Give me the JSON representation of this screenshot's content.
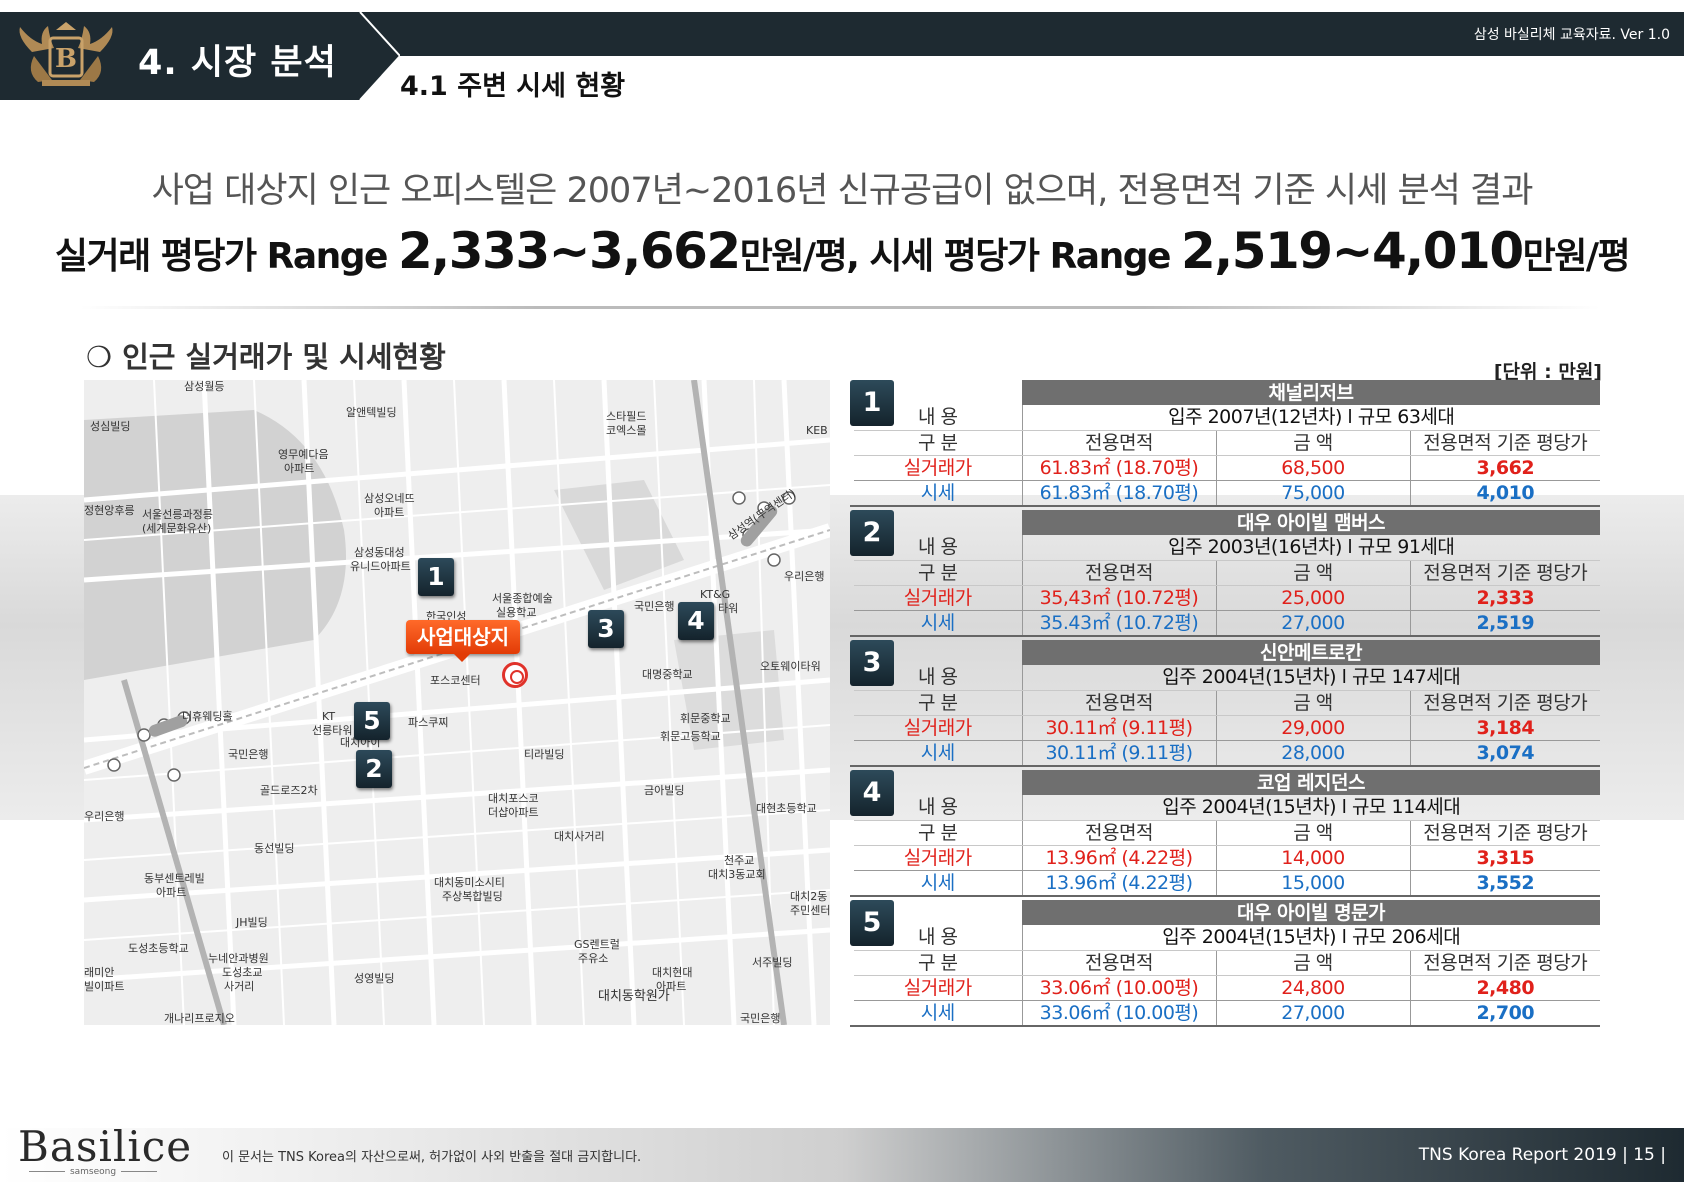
{
  "header": {
    "section_title": "4. 시장 분석",
    "subsection_title": "4.1 주변 시세 현황",
    "doc_version": "삼성 바실리체 교육자료. Ver 1.0"
  },
  "headline": {
    "line1": "사업 대상지 인근 오피스텔은 2007년~2016년 신규공급이 없으며, 전용면적 기준 시세 분석 결과",
    "line2_a": "실거래 평당가 Range ",
    "line2_b": "2,333~3,662",
    "line2_c": "만원/평, 시세 평당가 Range ",
    "line2_d": "2,519~4,010",
    "line2_e": "만원/평"
  },
  "block": {
    "heading": "❍ 인근 실거래가 및 시세현황",
    "unit": "[단위 : 만원]"
  },
  "map": {
    "site_label": "사업대상지",
    "pins": [
      "1",
      "2",
      "3",
      "4",
      "5"
    ],
    "labels": [
      "삼성월등",
      "알앤텍빌딩",
      "스타필드",
      "코엑스몰",
      "성심빌딩",
      "영무예다음",
      "아파트",
      "KEB",
      "삼성오네뜨",
      "아파트",
      "서울선릉과정릉",
      "(세계문화유산)",
      "정현앙후릉",
      "삼성동대성",
      "유니드아파트",
      "우리은행",
      "삼성역(무역센터)",
      "서울종합예술",
      "실용학교",
      "국민은행",
      "KT&G",
      "타워",
      "한국인성",
      "포스코센터",
      "대명중학교",
      "오토웨이타워",
      "더휴웨딩홀",
      "KT",
      "선릉타워",
      "파스쿠찌",
      "휘문중학교",
      "휘문고등학교",
      "국민은행",
      "대치아이",
      "티라빌딩",
      "골드로즈2차",
      "금아빌딩",
      "대현초등학교",
      "대치포스코",
      "더샵아파트",
      "우리은행",
      "대치사거리",
      "동선빌딩",
      "천주교",
      "대치3동교회",
      "동부센트레빌",
      "아파트",
      "대치동미소시티",
      "주상복합빌딩",
      "대치2동",
      "주민센터",
      "JH빌딩",
      "GS렌트럴",
      "주유소",
      "도성초등학교",
      "누네안과병원",
      "서주빌딩",
      "래미안",
      "빌이파트",
      "도성초교",
      "사거리",
      "성영빌딩",
      "대치현대",
      "아파트",
      "대치동학원가",
      "개나리프로지오",
      "국민은행"
    ]
  },
  "properties": [
    {
      "num": "1",
      "name": "채널리저브",
      "info_label": "내 용",
      "info": "입주  2007년(12년차)   l   규모 63세대",
      "header": [
        "구 분",
        "전용면적",
        "금 액",
        "전용면적 기준 평당가"
      ],
      "rows": [
        {
          "type": "실거래가",
          "area": "61.83㎡ (18.70평)",
          "amount": "68,500",
          "ppp": "3,662"
        },
        {
          "type": "시세",
          "area": "61.83㎡ (18.70평)",
          "amount": "75,000",
          "ppp": "4,010"
        }
      ]
    },
    {
      "num": "2",
      "name": "대우 아이빌  맴버스",
      "info_label": "내 용",
      "info": "입주  2003년(16년차)   l   규모 91세대",
      "header": [
        "구 분",
        "전용면적",
        "금 액",
        "전용면적 기준 평당가"
      ],
      "rows": [
        {
          "type": "실거래가",
          "area": "35,43㎡ (10.72평)",
          "amount": "25,000",
          "ppp": "2,333"
        },
        {
          "type": "시세",
          "area": "35.43㎡ (10.72평)",
          "amount": "27,000",
          "ppp": "2,519"
        }
      ]
    },
    {
      "num": "3",
      "name": "신안메트로칸",
      "info_label": "내 용",
      "info": "입주  2004년(15년차)   l   규모 147세대",
      "header": [
        "구 분",
        "전용면적",
        "금 액",
        "전용면적 기준 평당가"
      ],
      "rows": [
        {
          "type": "실거래가",
          "area": "30.11㎡ (9.11평)",
          "amount": "29,000",
          "ppp": "3,184"
        },
        {
          "type": "시세",
          "area": "30.11㎡ (9.11평)",
          "amount": "28,000",
          "ppp": "3,074"
        }
      ]
    },
    {
      "num": "4",
      "name": "코업 레지던스",
      "info_label": "내 용",
      "info": "입주  2004년(15년차)   l   규모 114세대",
      "header": [
        "구 분",
        "전용면적",
        "금 액",
        "전용면적 기준 평당가"
      ],
      "rows": [
        {
          "type": "실거래가",
          "area": "13.96㎡ (4.22평)",
          "amount": "14,000",
          "ppp": "3,315"
        },
        {
          "type": "시세",
          "area": "13.96㎡ (4.22평)",
          "amount": "15,000",
          "ppp": "3,552"
        }
      ]
    },
    {
      "num": "5",
      "name": "대우 아이빌 명문가",
      "info_label": "내 용",
      "info": "입주  2004년(15년차)   l   규모 206세대",
      "header": [
        "구 분",
        "전용면적",
        "금 액",
        "전용면적 기준 평당가"
      ],
      "rows": [
        {
          "type": "실거래가",
          "area": "33.06㎡ (10.00평)",
          "amount": "24,800",
          "ppp": "2,480"
        },
        {
          "type": "시세",
          "area": "33.06㎡ (10.00평)",
          "amount": "27,000",
          "ppp": "2,700"
        }
      ]
    }
  ],
  "footer": {
    "brand": "Basilice",
    "brand_sub": "samseong",
    "notice": "이 문서는 TNS Korea의 자산으로써, 허가없이 사외 반출을 절대 금지합니다.",
    "report": "TNS Korea Report 2019   |  15  |"
  },
  "colors": {
    "navy": "#1e2a31",
    "deal_red": "#e0211b",
    "market_blue": "#1a6fc4",
    "site_orange": "#e23b06"
  }
}
